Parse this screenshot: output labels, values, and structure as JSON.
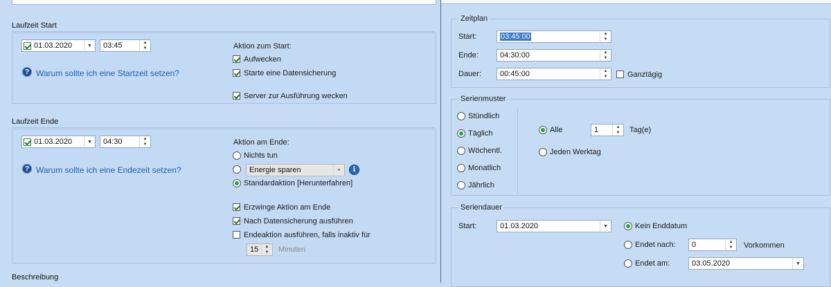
{
  "left": {
    "start_section": {
      "title": "Laufzeit Start",
      "date": "01.03.2020",
      "time": "03:45",
      "help_link": "Warum sollte ich eine Startzeit setzen?",
      "action_label": "Aktion zum Start:",
      "options": [
        {
          "label": "Aufwecken",
          "checked": true
        },
        {
          "label": "Starte eine Datensicherung",
          "checked": true
        },
        {
          "label": "Server zur Ausführung wecken",
          "checked": true
        }
      ]
    },
    "end_section": {
      "title": "Laufzeit Ende",
      "date": "01.03.2020",
      "time": "04:30",
      "help_link": "Warum sollte ich eine Endezeit setzen?",
      "action_label": "Aktion am Ende:",
      "radios": [
        {
          "label": "Nichts tun",
          "selected": false
        },
        {
          "label": "",
          "selected": false
        },
        {
          "label": "Standardaktion [Herunterfahren]",
          "selected": true
        }
      ],
      "energy_dropdown": "Energie sparen",
      "checks": [
        {
          "label": "Erzwinge Aktion am Ende",
          "checked": true
        },
        {
          "label": "Nach Datensicherung ausführen",
          "checked": true
        },
        {
          "label": "Endeaktion ausführen, falls inaktiv für",
          "checked": false
        }
      ],
      "minutes_value": "15",
      "minutes_label": "Minuten"
    },
    "description_title": "Beschreibung"
  },
  "right": {
    "zeitplan": {
      "legend": "Zeitplan",
      "start_label": "Start:",
      "start_value": "03:45:00",
      "end_label": "Ende:",
      "end_value": "04:30:00",
      "duration_label": "Dauer:",
      "duration_value": "00:45:00",
      "allday_label": "Ganztägig"
    },
    "serienmuster": {
      "legend": "Serienmuster",
      "options": [
        {
          "label": "Stündlich",
          "selected": false
        },
        {
          "label": "Täglich",
          "selected": true
        },
        {
          "label": "Wöchentl.",
          "selected": false
        },
        {
          "label": "Monatlich",
          "selected": false
        },
        {
          "label": "Jährlich",
          "selected": false
        }
      ],
      "every_label": "Alle",
      "every_value": "1",
      "every_unit": "Tag(e)",
      "weekday_label": "Jeden Werktag"
    },
    "seriendauer": {
      "legend": "Seriendauer",
      "start_label": "Start:",
      "start_value": "01.03.2020",
      "no_end_label": "Kein Enddatum",
      "end_after_label": "Endet nach:",
      "end_after_value": "0",
      "occurrences_label": "Vorkommen",
      "end_on_label": "Endet am:",
      "end_on_value": "03.05.2020"
    }
  },
  "colors": {
    "background": "#c6dcf5",
    "link": "#1f5fae",
    "radio_selected": "#22a33a",
    "selection": "#3a78c8"
  }
}
